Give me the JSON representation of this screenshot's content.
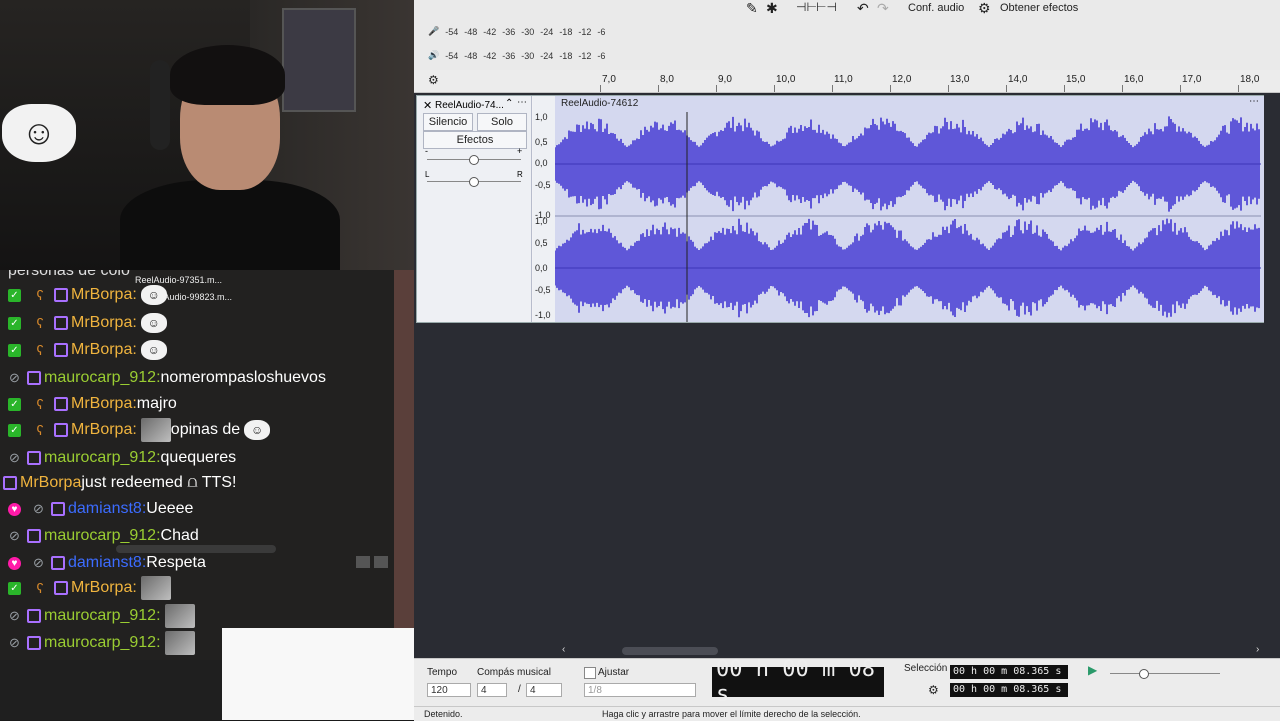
{
  "overlay": {
    "file_labels": [
      "ReelAudio-97351.m...",
      "ReelAudio-99823.m..."
    ],
    "clipped_text": "personas de colo"
  },
  "chat": {
    "messages": [
      {
        "badges": [
          "green",
          "bear",
          "twitch"
        ],
        "user": "MrBorpa",
        "user_color": "gold",
        "text": "",
        "emote": "troll"
      },
      {
        "badges": [
          "green",
          "bear",
          "twitch"
        ],
        "user": "MrBorpa",
        "user_color": "gold",
        "text": "",
        "emote": "troll"
      },
      {
        "badges": [
          "green",
          "bear",
          "twitch"
        ],
        "user": "MrBorpa",
        "user_color": "gold",
        "text": "",
        "emote": "troll"
      },
      {
        "badges": [
          "grey",
          "twitch"
        ],
        "user": "maurocarp_912",
        "user_color": "green",
        "text": "nomerompasloshuevos",
        "emote": ""
      },
      {
        "badges": [
          "green",
          "bear",
          "twitch"
        ],
        "user": "MrBorpa",
        "user_color": "gold",
        "text": "majro",
        "emote": ""
      },
      {
        "badges": [
          "green",
          "bear",
          "twitch"
        ],
        "user": "MrBorpa",
        "user_color": "gold",
        "text": "opinas de",
        "emote": "img+troll"
      },
      {
        "badges": [
          "grey",
          "twitch"
        ],
        "user": "maurocarp_912",
        "user_color": "green",
        "text": "quequeres",
        "emote": ""
      },
      {
        "badges": [
          "twitch"
        ],
        "user": "MrBorpa",
        "user_color": "gold",
        "text": "just redeemed ⩍ TTS!",
        "emote": "",
        "redeem": true
      },
      {
        "badges": [
          "pink",
          "grey",
          "twitch"
        ],
        "user": "damianst8",
        "user_color": "blue",
        "text": "Ueeee",
        "emote": ""
      },
      {
        "badges": [
          "grey",
          "twitch"
        ],
        "user": "maurocarp_912",
        "user_color": "green",
        "text": "Chad",
        "emote": ""
      },
      {
        "badges": [
          "pink",
          "grey",
          "twitch"
        ],
        "user": "damianst8",
        "user_color": "blue",
        "text": "Respeta",
        "emote": ""
      },
      {
        "badges": [
          "green",
          "bear",
          "twitch"
        ],
        "user": "MrBorpa",
        "user_color": "gold",
        "text": "",
        "emote": "img"
      },
      {
        "badges": [
          "grey",
          "twitch"
        ],
        "user": "maurocarp_912",
        "user_color": "green",
        "text": "",
        "emote": "img"
      },
      {
        "badges": [
          "grey",
          "twitch"
        ],
        "user": "maurocarp_912",
        "user_color": "green",
        "text": "",
        "emote": "img"
      }
    ]
  },
  "audacity": {
    "toolbar": {
      "conf_audio": "Conf. audio",
      "obtener_efectos": "Obtener efectos"
    },
    "meter_scale": [
      "-54",
      "-48",
      "-42",
      "-36",
      "-30",
      "-24",
      "-18",
      "-12",
      "-6"
    ],
    "ruler_ticks": [
      "7,0",
      "8,0",
      "9,0",
      "10,0",
      "11,0",
      "12,0",
      "13,0",
      "14,0",
      "15,0",
      "16,0",
      "17,0",
      "18,0"
    ],
    "track": {
      "name": "ReelAudio-74...",
      "clip_name": "ReelAudio-74612",
      "silence": "Silencio",
      "solo": "Solo",
      "effects": "Efectos",
      "pan_left": "L",
      "pan_right": "R",
      "gain_minus": "-",
      "gain_plus": "+",
      "vscale": [
        "1,0",
        "0,5",
        "0,0",
        "-0,5",
        "-1,0",
        "1,0",
        "0,5",
        "0,0",
        "-0,5",
        "-1,0"
      ]
    },
    "bottom": {
      "tempo_label": "Tempo",
      "tempo_value": "120",
      "meter_label": "Compás musical",
      "meter_num": "4",
      "meter_slash": "/",
      "meter_den": "4",
      "snap_label": "Ajustar",
      "snap_value": "1/8",
      "time_display": "00 h 00 m 08 s",
      "selection_label": "Selección",
      "sel_start": "00 h 00 m 08.365 s",
      "sel_end": "00 h 00 m 08.365 s"
    },
    "status": {
      "left": "Detenido.",
      "hint": "Haga clic y arrastre para mover el límite derecho de la selección."
    },
    "colors": {
      "waveform": "#5f57d8",
      "wave_bg": "#d4d8ef"
    }
  }
}
